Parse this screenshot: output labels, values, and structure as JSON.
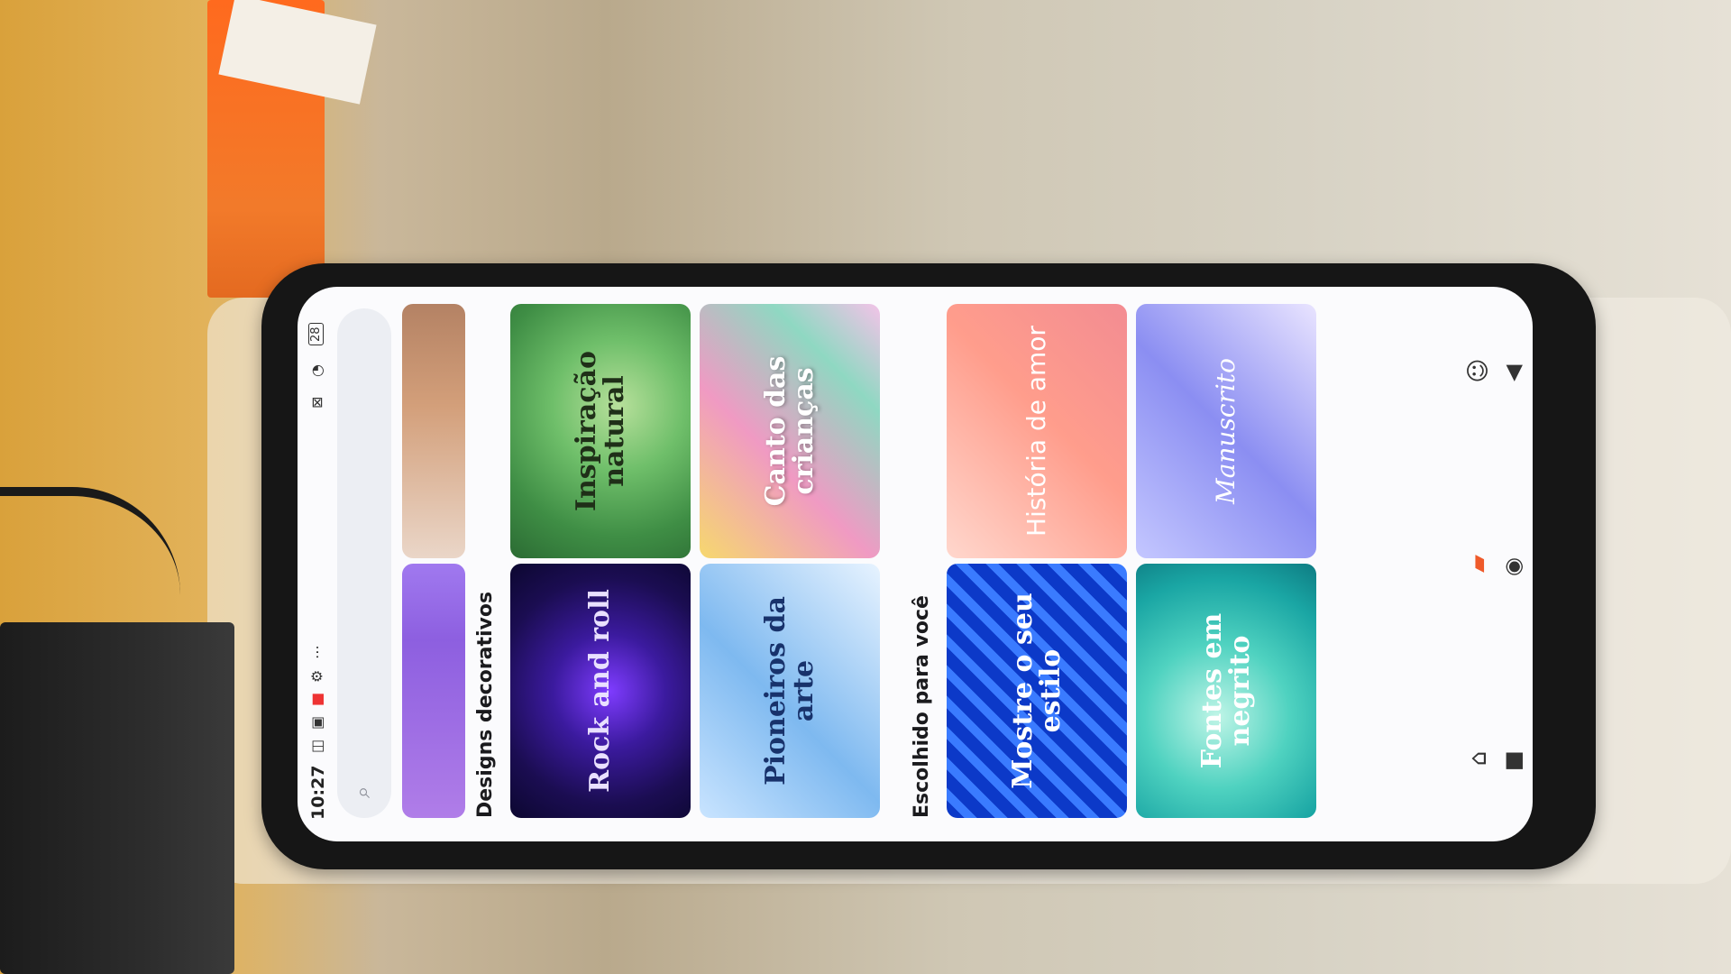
{
  "status": {
    "time": "10:27",
    "battery": "28"
  },
  "sections": {
    "decorative": "Designs decorativos",
    "for_you": "Escolhido para você"
  },
  "cards": {
    "rock": "Rock and roll",
    "inspiracao": "Inspiração natural",
    "pioneiros": "Pioneiros da arte",
    "canto": "Canto das crianças",
    "mostre": "Mostre o seu estilo",
    "historia": "História de amor",
    "fontes": "Fontes em negrito",
    "manuscrito": "Manuscrito"
  },
  "icons": {
    "search": "search-icon",
    "home_tab": "tag-icon",
    "themes_tab": "bookmark-icon",
    "profile_tab": "smile-icon"
  }
}
